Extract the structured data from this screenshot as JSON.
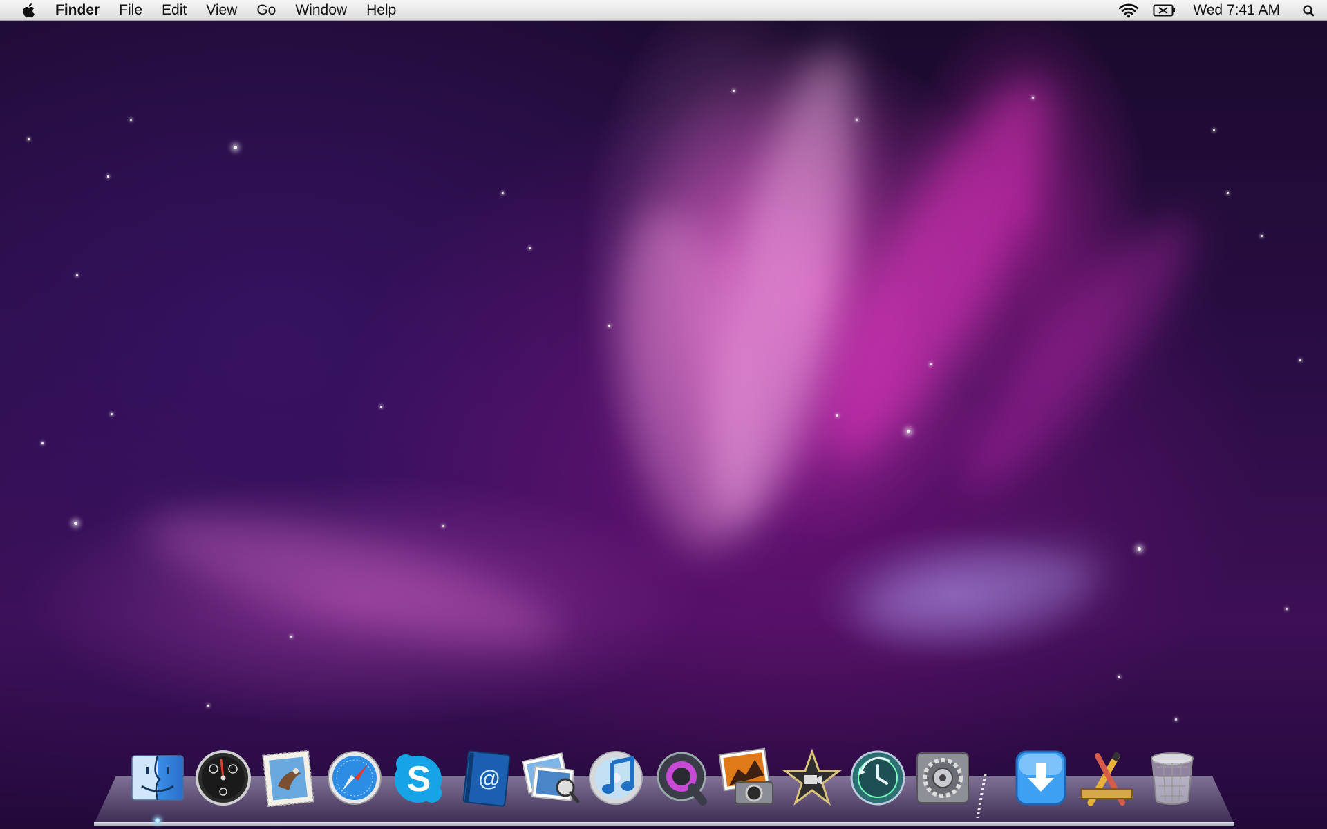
{
  "menubar": {
    "apple_icon": "apple-logo-icon",
    "app_name": "Finder",
    "menus": [
      "File",
      "Edit",
      "View",
      "Go",
      "Window",
      "Help"
    ],
    "status": {
      "wifi_icon": "wifi-icon",
      "battery_icon": "battery-charging-icon",
      "clock": "Wed 7:41 AM",
      "spotlight_icon": "spotlight-search-icon"
    }
  },
  "dock": {
    "items": [
      {
        "name": "finder",
        "icon": "finder-icon"
      },
      {
        "name": "dashboard",
        "icon": "dashboard-icon"
      },
      {
        "name": "mail",
        "icon": "mail-icon"
      },
      {
        "name": "safari",
        "icon": "safari-icon"
      },
      {
        "name": "skype",
        "icon": "skype-icon"
      },
      {
        "name": "address-book",
        "icon": "address-book-icon"
      },
      {
        "name": "iphoto-viewer",
        "icon": "preview-icon"
      },
      {
        "name": "itunes",
        "icon": "itunes-icon"
      },
      {
        "name": "quicktime",
        "icon": "quicktime-icon"
      },
      {
        "name": "photo-booth",
        "icon": "photo-booth-icon"
      },
      {
        "name": "imovie",
        "icon": "imovie-icon"
      },
      {
        "name": "time-machine",
        "icon": "time-machine-icon"
      },
      {
        "name": "system-preferences",
        "icon": "system-preferences-icon"
      },
      {
        "name": "downloads",
        "icon": "downloads-stack-icon"
      },
      {
        "name": "applications",
        "icon": "applications-stack-icon"
      },
      {
        "name": "trash",
        "icon": "trash-icon"
      }
    ],
    "running": [
      "finder"
    ]
  },
  "colors": {
    "menubar": "#e6e6e6",
    "wallpaper_accent": "#e040c8",
    "wallpaper_base": "#1a0a2c"
  }
}
